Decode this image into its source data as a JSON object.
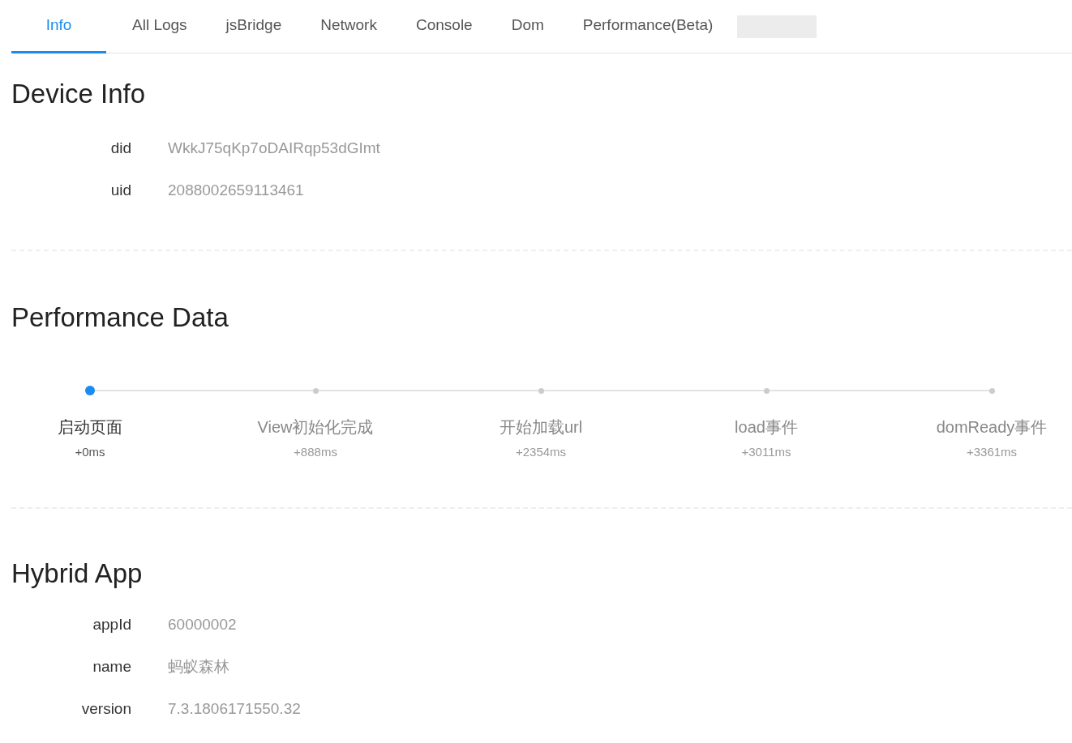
{
  "tabs": [
    {
      "label": "Info",
      "selected": true
    },
    {
      "label": "All Logs",
      "selected": false
    },
    {
      "label": "jsBridge",
      "selected": false
    },
    {
      "label": "Network",
      "selected": false
    },
    {
      "label": "Console",
      "selected": false
    },
    {
      "label": "Dom",
      "selected": false
    },
    {
      "label": "Performance(Beta)",
      "selected": false
    }
  ],
  "device_info": {
    "title": "Device Info",
    "fields": [
      {
        "label": "did",
        "value": "WkkJ75qKp7oDAIRqp53dGImt"
      },
      {
        "label": "uid",
        "value": "2088002659113461"
      }
    ]
  },
  "performance_data": {
    "title": "Performance Data",
    "steps": [
      {
        "label": "启动页面",
        "time": "+0ms",
        "selected": true
      },
      {
        "label": "View初始化完成",
        "time": "+888ms",
        "selected": false
      },
      {
        "label": "开始加载url",
        "time": "+2354ms",
        "selected": false
      },
      {
        "label": "load事件",
        "time": "+3011ms",
        "selected": false
      },
      {
        "label": "domReady事件",
        "time": "+3361ms",
        "selected": false
      }
    ]
  },
  "hybrid_app": {
    "title": "Hybrid App",
    "fields": [
      {
        "label": "appId",
        "value": "60000002"
      },
      {
        "label": "name",
        "value": "蚂蚁森林"
      },
      {
        "label": "version",
        "value": "7.3.1806171550.32"
      }
    ]
  }
}
